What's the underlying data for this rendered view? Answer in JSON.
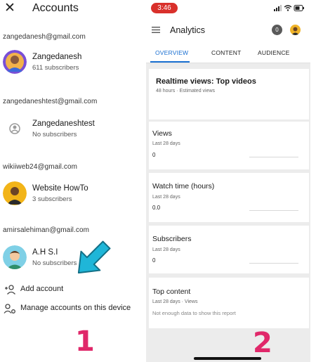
{
  "accounts_panel": {
    "title": "Accounts",
    "close_icon": "close-icon",
    "accounts": [
      {
        "email": "zangedanesh@gmail.com",
        "name": "Zangedanesh",
        "subscribers": "611 subscribers"
      },
      {
        "email": "zangedaneshtest@gmail.com",
        "name": "Zangedaneshtest",
        "subscribers": "No subscribers"
      },
      {
        "email": "wikiiweb24@gmail.com",
        "name": "Website HowTo",
        "subscribers": "3 subscribers"
      },
      {
        "email": "amirsalehiman@gmail.com",
        "name": "A.H S.I",
        "subscribers": "No subscribers"
      }
    ],
    "actions": {
      "add_account": "Add account",
      "manage_accounts": "Manage accounts on this device"
    },
    "step_number": "1",
    "arrow_color": "#1fb6d8"
  },
  "analytics_panel": {
    "status_bar": {
      "time": "3:46"
    },
    "app_bar": {
      "title": "Analytics",
      "notification_count": "0"
    },
    "tabs": [
      {
        "label": "OVERVIEW",
        "active": true
      },
      {
        "label": "CONTENT",
        "active": false
      },
      {
        "label": "AUDIENCE",
        "active": false
      }
    ],
    "realtime": {
      "title": "Realtime views: Top videos",
      "subtitle": "48 hours · Estimated views"
    },
    "metrics": [
      {
        "title": "Views",
        "period": "Last 28 days",
        "value": "0"
      },
      {
        "title": "Watch time (hours)",
        "period": "Last 28 days",
        "value": "0.0"
      },
      {
        "title": "Subscribers",
        "period": "Last 28 days",
        "value": "0"
      }
    ],
    "top_content": {
      "title": "Top content",
      "subtitle": "Last 28 days · Views",
      "message": "Not enough data to show this report"
    },
    "step_number": "2"
  },
  "colors": {
    "accent_blue": "#1a6fd1",
    "step_number": "#e0286a",
    "time_pill": "#d9302b"
  }
}
